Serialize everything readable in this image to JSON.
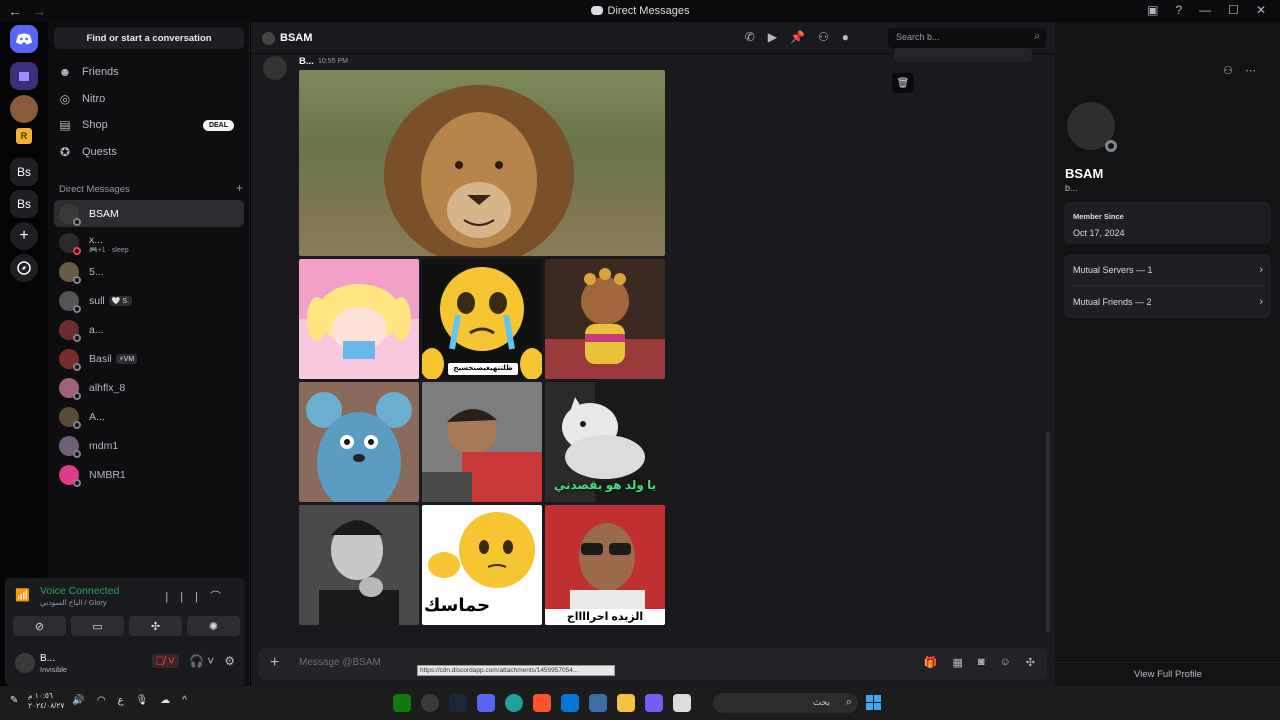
{
  "window": {
    "title": "Direct Messages"
  },
  "sidebar": {
    "find_label": "Find or start a conversation",
    "nav": [
      {
        "label": "Friends",
        "icon": "friends-icon"
      },
      {
        "label": "Nitro",
        "icon": "nitro-icon"
      },
      {
        "label": "Shop",
        "icon": "shop-icon",
        "badge": "DEAL"
      },
      {
        "label": "Quests",
        "icon": "quests-icon"
      }
    ],
    "dm_header": "Direct Messages",
    "dm_add": "+",
    "dms": [
      {
        "name": "BSAM",
        "active": true
      },
      {
        "name": "x...",
        "sub": "🎮+1 · sleep"
      },
      {
        "name": "5..."
      },
      {
        "name": "sull",
        "badge": "🤍 S."
      },
      {
        "name": "a..."
      },
      {
        "name": "Basil",
        "badge": "⚡VM"
      },
      {
        "name": "alhflx_8"
      },
      {
        "name": "A..."
      },
      {
        "name": "mdm1"
      },
      {
        "name": "NMBR1"
      }
    ],
    "rail_letters": [
      "Bs",
      "Bs"
    ]
  },
  "voice": {
    "title": "Voice Connected",
    "channel": "الباح السودني / Glory"
  },
  "user": {
    "name": "B...",
    "status": "Invisible"
  },
  "chat": {
    "name": "BSAM",
    "search_placeholder": "Search b...",
    "author": "B...",
    "time": "10:55 PM",
    "composer_placeholder": "Message @BSAM",
    "hover_url": "https://cdn.discordapp.com/attachments/1459957054...",
    "captions": {
      "emoji_caption": "ظلتتهيغيضنحسيج",
      "cat_caption": "يا ولد هو بقصدني",
      "emoji2_caption": "حماسك",
      "man2_caption": "الزبده احرااااج"
    }
  },
  "profile": {
    "name": "BSAM",
    "username": "b...",
    "member_since_label": "Member Since",
    "member_since": "Oct 17, 2024",
    "mutual_servers": "Mutual Servers — 1",
    "mutual_friends": "Mutual Friends — 2",
    "view_full": "View Full Profile"
  },
  "taskbar": {
    "time": "١٠:٥٦ م",
    "date": "٢٠٢٤/٠٨/٢٧",
    "lang": "ع",
    "search_placeholder": "بحث"
  },
  "colors": {
    "accent": "#5865f2",
    "online": "#23a55a",
    "danger": "#f23f43"
  }
}
